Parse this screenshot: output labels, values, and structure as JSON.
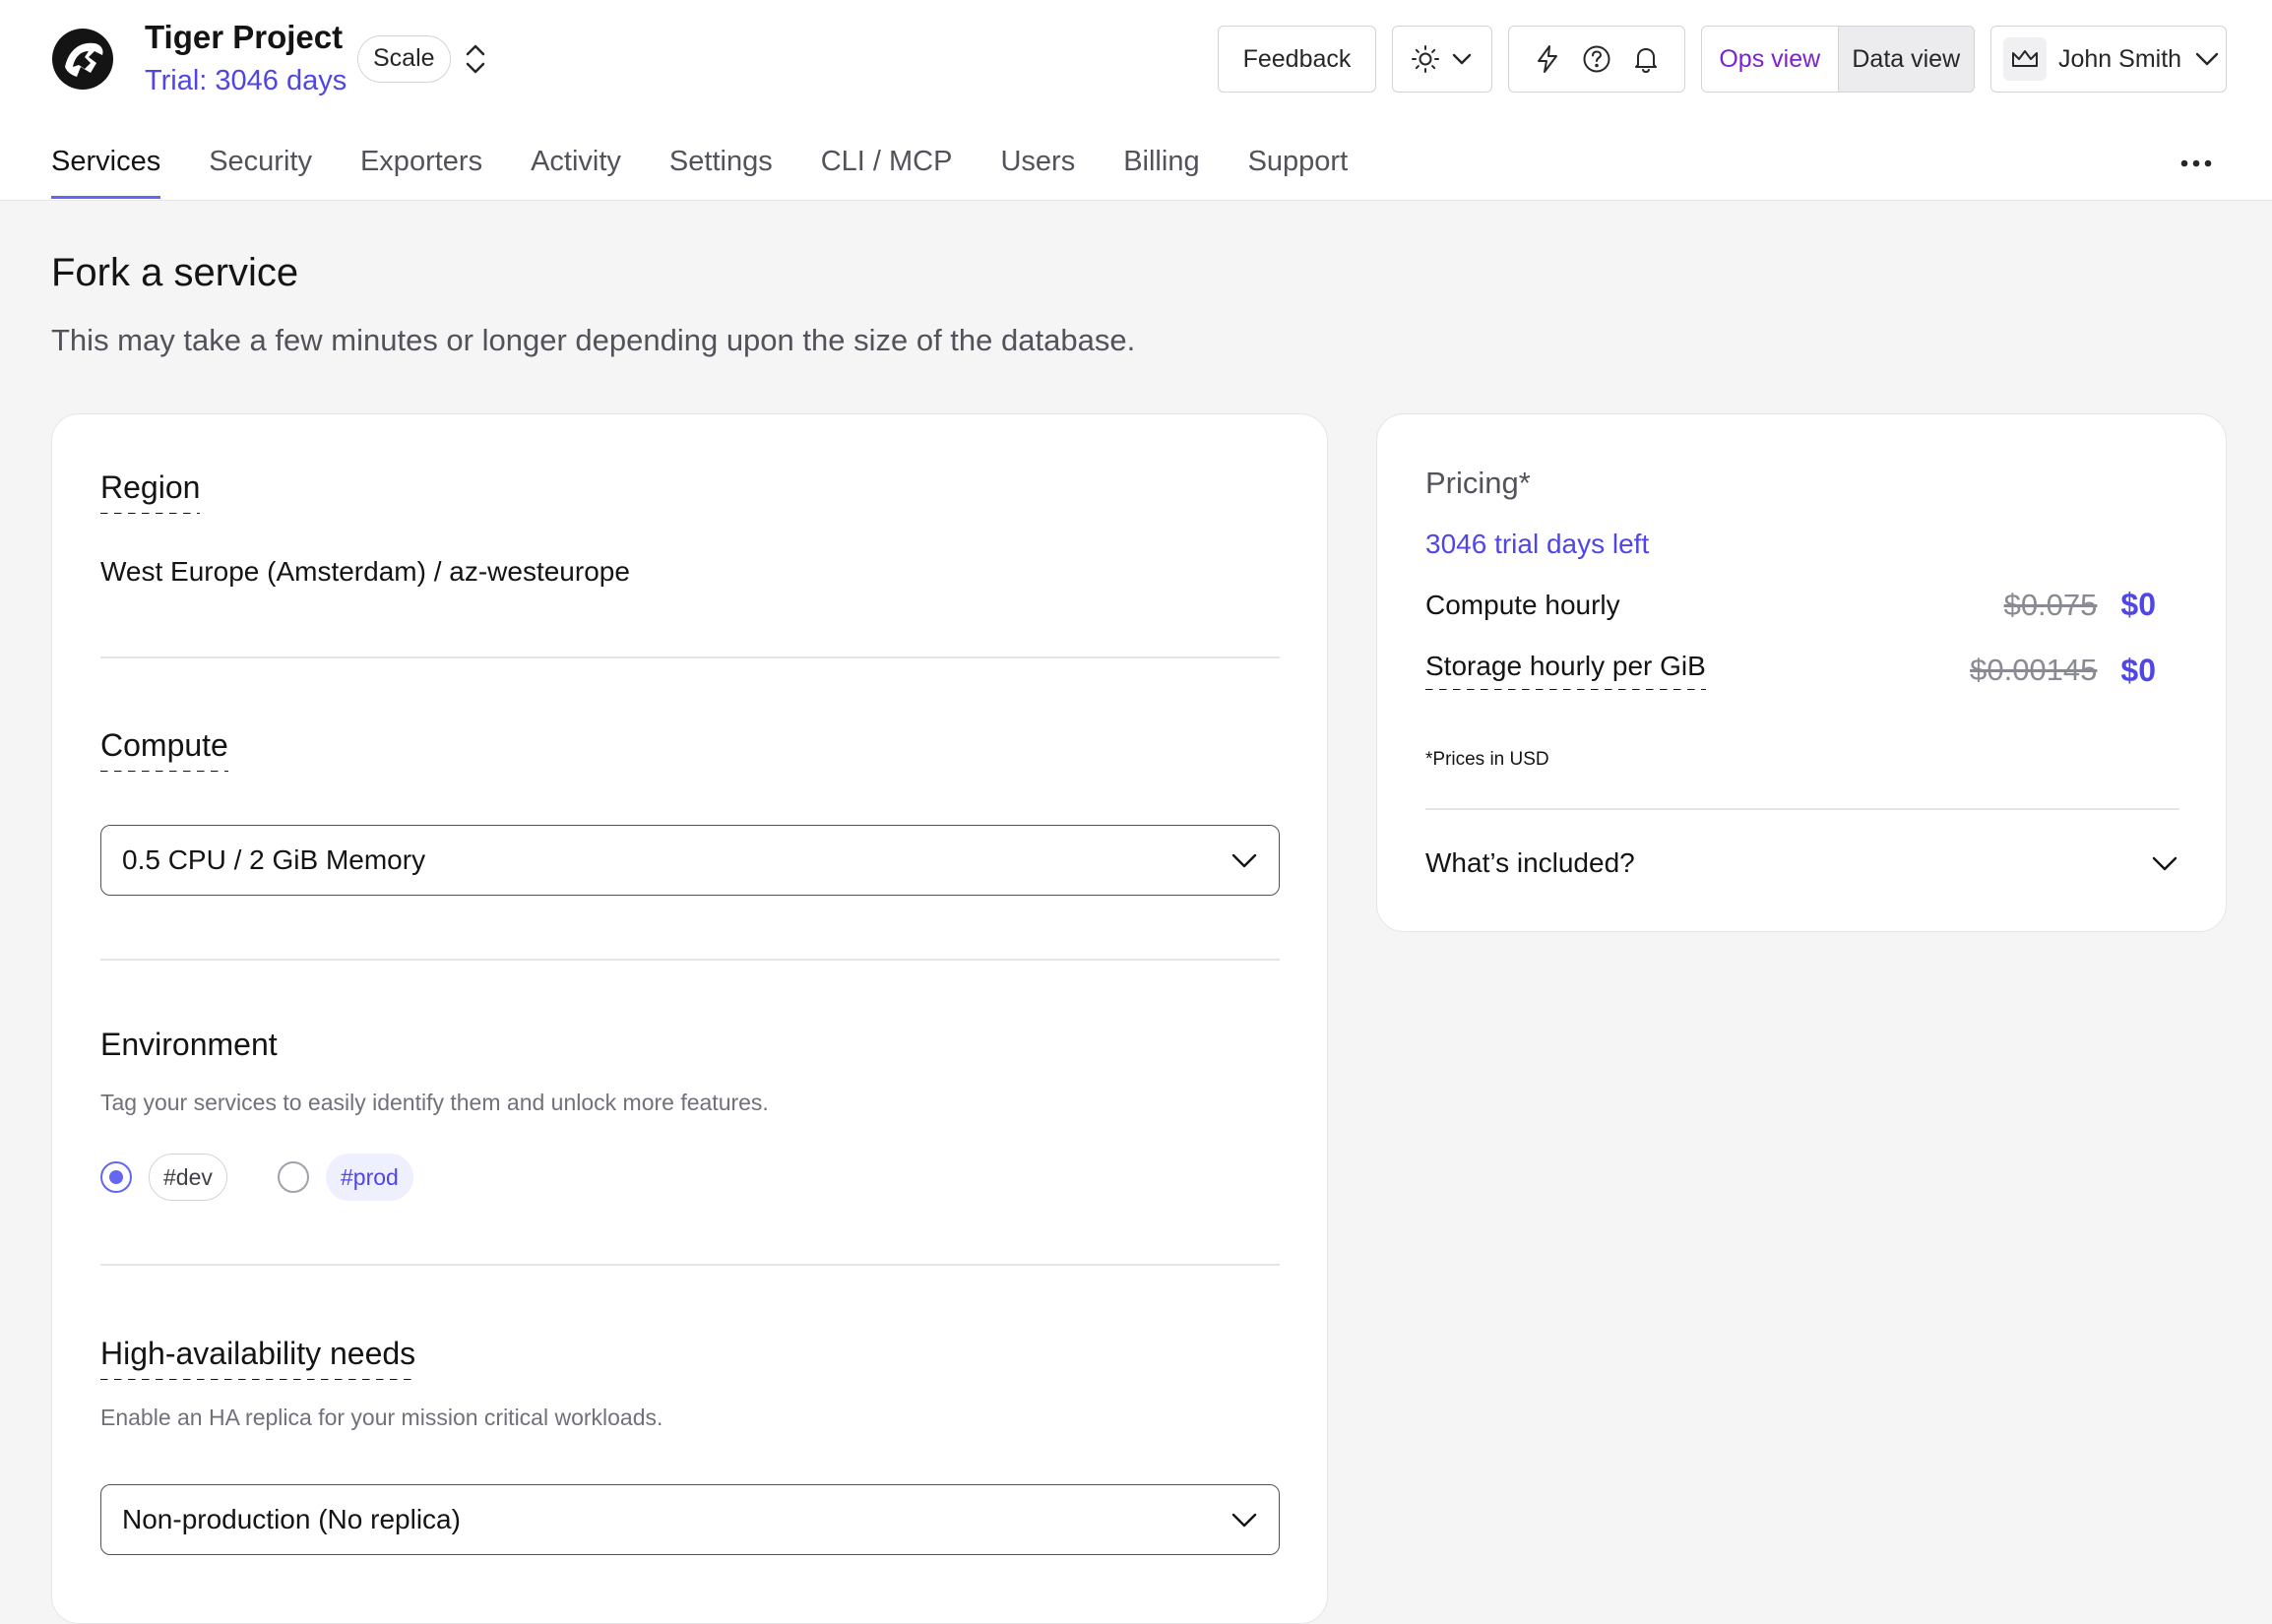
{
  "header": {
    "project_name": "Tiger Project",
    "trial_label": "Trial: 3046 days",
    "plan_badge": "Scale",
    "feedback_label": "Feedback",
    "views": {
      "ops_label": "Ops view",
      "data_label": "Data view",
      "active": "Ops view"
    },
    "user_name": "John Smith",
    "icons": [
      "logo-icon",
      "chevron-up-down-icon",
      "sun-icon",
      "chevron-down-icon",
      "lightning-icon",
      "help-icon",
      "bell-icon",
      "crown-icon",
      "more-icon"
    ]
  },
  "tabs": [
    {
      "label": "Services",
      "active": true
    },
    {
      "label": "Security",
      "active": false
    },
    {
      "label": "Exporters",
      "active": false
    },
    {
      "label": "Activity",
      "active": false
    },
    {
      "label": "Settings",
      "active": false
    },
    {
      "label": "CLI / MCP",
      "active": false
    },
    {
      "label": "Users",
      "active": false
    },
    {
      "label": "Billing",
      "active": false
    },
    {
      "label": "Support",
      "active": false
    }
  ],
  "page": {
    "title": "Fork a service",
    "subtitle": "This may take a few minutes or longer depending upon the size of the database."
  },
  "form": {
    "region": {
      "label": "Region",
      "value": "West Europe (Amsterdam) / az-westeurope"
    },
    "compute": {
      "label": "Compute",
      "selected": "0.5 CPU / 2 GiB Memory"
    },
    "environment": {
      "label": "Environment",
      "help": "Tag your services to easily identify them and unlock more features.",
      "options": [
        {
          "tag": "#dev",
          "checked": true
        },
        {
          "tag": "#prod",
          "checked": false
        }
      ]
    },
    "ha": {
      "label": "High-availability needs",
      "help": "Enable an HA replica for your mission critical workloads.",
      "selected": "Non-production (No replica)"
    }
  },
  "pricing": {
    "title": "Pricing*",
    "trial_left": "3046 trial days left",
    "rows": [
      {
        "name": "Compute hourly",
        "old": "$0.075",
        "new": "$0"
      },
      {
        "name": "Storage hourly per GiB",
        "old": "$0.00145",
        "new": "$0"
      }
    ],
    "footnote": "*Prices in USD",
    "included_label": "What’s included?"
  },
  "colors": {
    "accent": "#4f46e5",
    "active_view": "#7e22ce",
    "tab_underline": "#6366f1"
  }
}
